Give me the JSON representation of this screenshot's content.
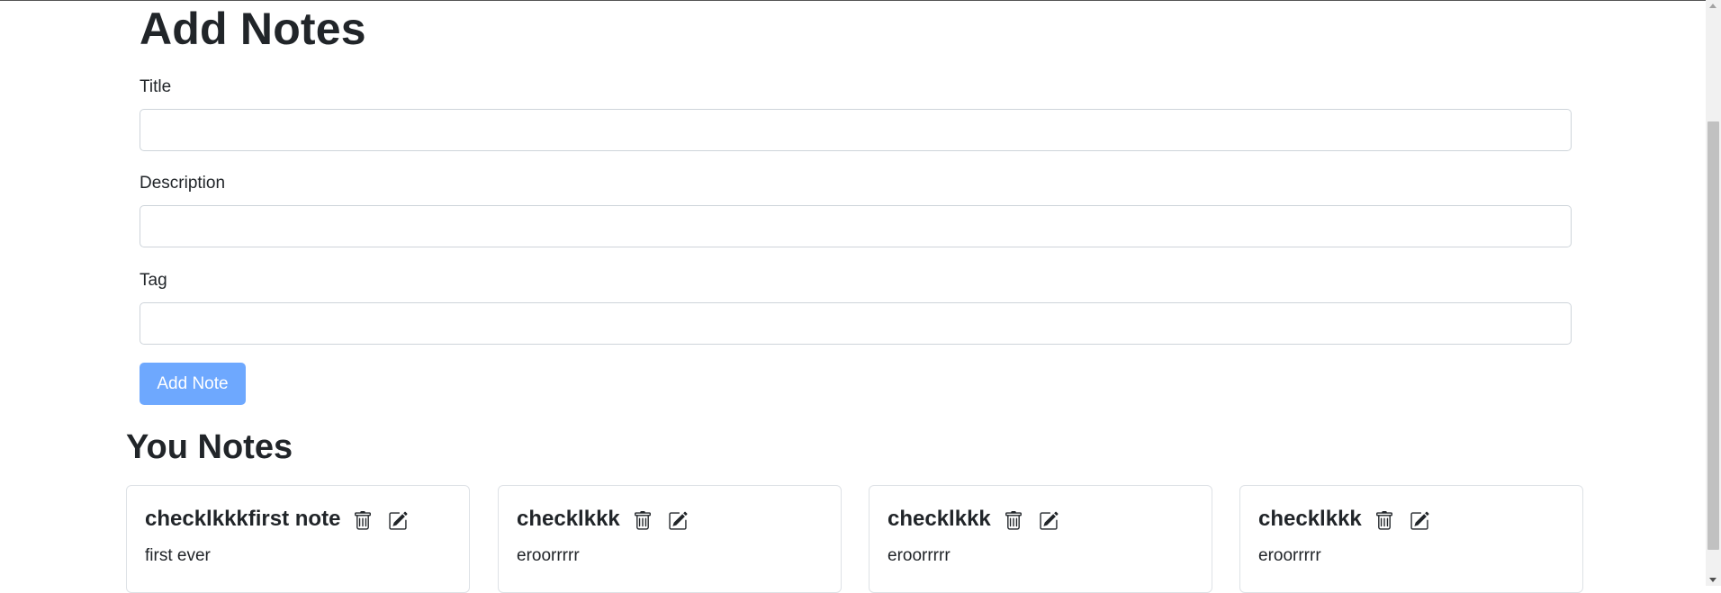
{
  "form": {
    "heading": "Add Notes",
    "fields": [
      {
        "label": "Title",
        "value": "",
        "placeholder": ""
      },
      {
        "label": "Description",
        "value": "",
        "placeholder": ""
      },
      {
        "label": "Tag",
        "value": "",
        "placeholder": ""
      }
    ],
    "submit_label": "Add Note",
    "submit_color": "#6ea8fe"
  },
  "notes_section": {
    "heading": "You Notes",
    "notes": [
      {
        "title": "checklkkkfirst note",
        "description": "first ever",
        "delete_icon": "trash-icon",
        "edit_icon": "edit-icon"
      },
      {
        "title": "checklkkk",
        "description": "eroorrrrr",
        "delete_icon": "trash-icon",
        "edit_icon": "edit-icon"
      },
      {
        "title": "checklkkk",
        "description": "eroorrrrr",
        "delete_icon": "trash-icon",
        "edit_icon": "edit-icon"
      },
      {
        "title": "checklkkk",
        "description": "eroorrrrr",
        "delete_icon": "trash-icon",
        "edit_icon": "edit-icon"
      }
    ]
  }
}
